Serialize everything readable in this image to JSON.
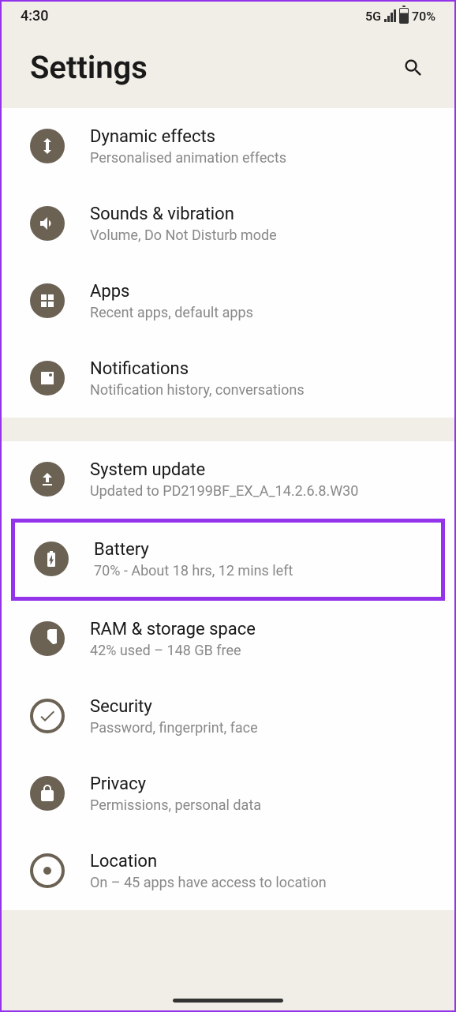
{
  "status": {
    "time": "4:30",
    "network": "5G",
    "battery": "70%"
  },
  "header": {
    "title": "Settings"
  },
  "items": {
    "dynamic_effects": {
      "title": "Dynamic effects",
      "sub": "Personalised animation effects"
    },
    "sounds": {
      "title": "Sounds & vibration",
      "sub": "Volume, Do Not Disturb mode"
    },
    "apps": {
      "title": "Apps",
      "sub": "Recent apps, default apps"
    },
    "notifications": {
      "title": "Notifications",
      "sub": "Notification history, conversations"
    },
    "system_update": {
      "title": "System update",
      "sub": "Updated to PD2199BF_EX_A_14.2.6.8.W30"
    },
    "battery": {
      "title": "Battery",
      "sub": "70% - About 18 hrs, 12 mins left"
    },
    "storage": {
      "title": "RAM & storage space",
      "sub": "42% used – 148 GB free"
    },
    "security": {
      "title": "Security",
      "sub": "Password, fingerprint, face"
    },
    "privacy": {
      "title": "Privacy",
      "sub": "Permissions, personal data"
    },
    "location": {
      "title": "Location",
      "sub": "On – 45 apps have access to location"
    }
  }
}
